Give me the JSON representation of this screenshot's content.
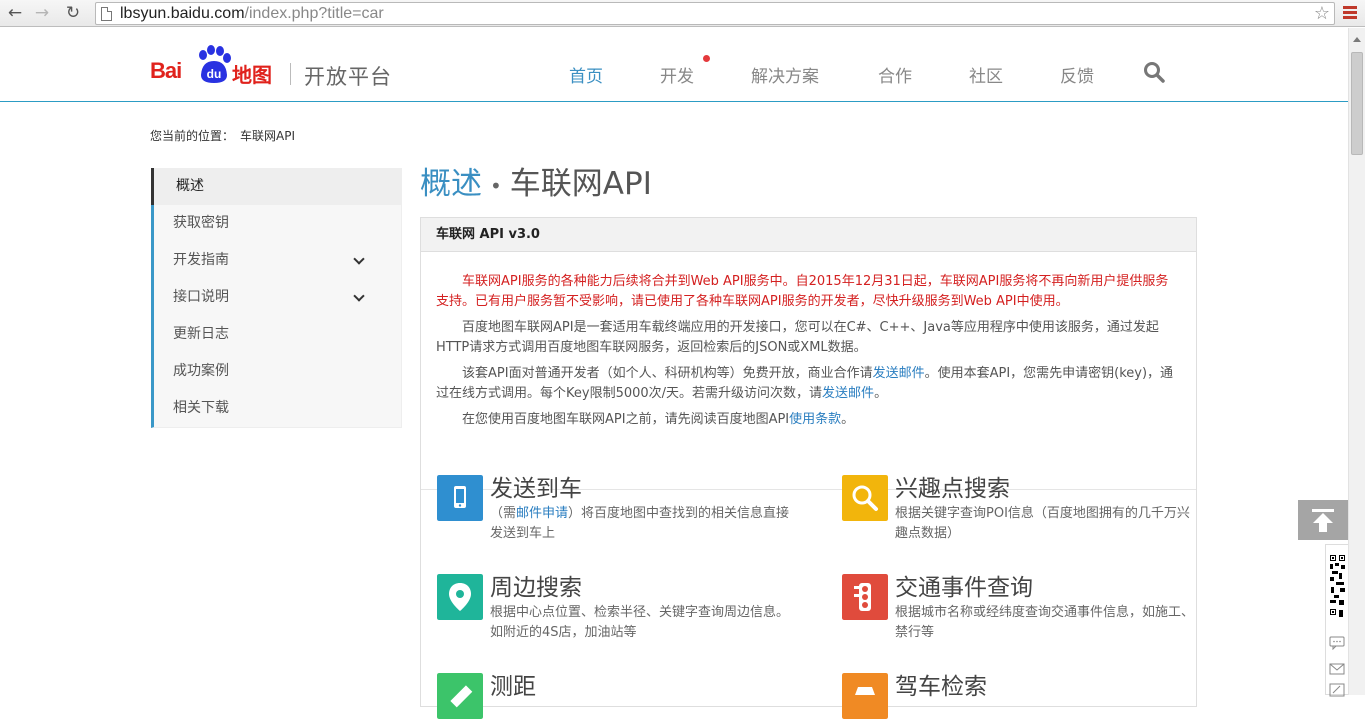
{
  "browser": {
    "url_host": "lbsyun.baidu.com",
    "url_path": "/index.php?title=car",
    "nav_back": "←",
    "nav_forward": "→",
    "nav_reload": "↻",
    "bookmark": "☆"
  },
  "header": {
    "logo_bai": "Bai",
    "logo_du": "du",
    "logo_map": "地图",
    "logo_sub": "开放平台",
    "nav": [
      "首页",
      "开发",
      "解决方案",
      "合作",
      "社区",
      "反馈"
    ],
    "accent_color": "#3a8fc2"
  },
  "breadcrumb": {
    "label": "您当前的位置：",
    "current": "车联网API"
  },
  "sidebar": {
    "items": [
      {
        "label": "概述"
      },
      {
        "label": "获取密钥"
      },
      {
        "label": "开发指南"
      },
      {
        "label": "接口说明"
      },
      {
        "label": "更新日志"
      },
      {
        "label": "成功案例"
      },
      {
        "label": "相关下载"
      }
    ]
  },
  "title": {
    "section": "概述",
    "separator": "•",
    "page": "车联网API"
  },
  "panel": {
    "heading": "车联网 API v3.0",
    "warning": "车联网API服务的各种能力后续将合并到Web API服务中。自2015年12月31日起，车联网API服务将不再向新用户提供服务支持。已有用户服务暂不受影响，请已使用了各种车联网API服务的开发者，尽快升级服务到Web API中使用。",
    "p1": "百度地图车联网API是一套适用车载终端应用的开发接口，您可以在C#、C++、Java等应用程序中使用该服务，通过发起HTTP请求方式调用百度地图车联网服务，返回检索后的JSON或XML数据。",
    "p2_a": "该套API面对普通开发者（如个人、科研机构等）免费开放，商业合作请",
    "p2_link1": "发送邮件",
    "p2_b": "。使用本套API，您需先申请密钥(key)，通过在线方式调用。每个Key限制5000次/天。若需升级访问次数，请",
    "p2_link2": "发送邮件",
    "p2_c": "。",
    "p3_a": "在您使用百度地图车联网API之前，请先阅读百度地图API",
    "p3_link": "使用条款",
    "p3_c": "。"
  },
  "features": [
    {
      "title": "发送到车",
      "desc_a": "（需",
      "desc_link": "邮件申请",
      "desc_b": "）将百度地图中查找到的相关信息直接发送到车上",
      "color": "#2f8fd0",
      "icon": "phone-icon"
    },
    {
      "title": "兴趣点搜索",
      "desc_a": "根据关键字查询POI信息（百度地图拥有的几千万兴趣点数据）",
      "desc_link": "",
      "desc_b": "",
      "color": "#f2b50c",
      "icon": "magnifier-icon"
    },
    {
      "title": "周边搜索",
      "desc_a": "根据中心点位置、检索半径、关键字查询周边信息。如附近的4S店，加油站等",
      "desc_link": "",
      "desc_b": "",
      "color": "#1fb59a",
      "icon": "location-pin-icon"
    },
    {
      "title": "交通事件查询",
      "desc_a": "根据城市名称或经纬度查询交通事件信息，如施工、禁行等",
      "desc_link": "",
      "desc_b": "",
      "color": "#e04b3c",
      "icon": "traffic-light-icon"
    },
    {
      "title": "测距",
      "desc_a": "",
      "desc_link": "",
      "desc_b": "",
      "color": "#3cc46a",
      "icon": "ruler-icon"
    },
    {
      "title": "驾车检索",
      "desc_a": "",
      "desc_link": "",
      "desc_b": "",
      "color": "#f08a24",
      "icon": "car-icon"
    }
  ]
}
